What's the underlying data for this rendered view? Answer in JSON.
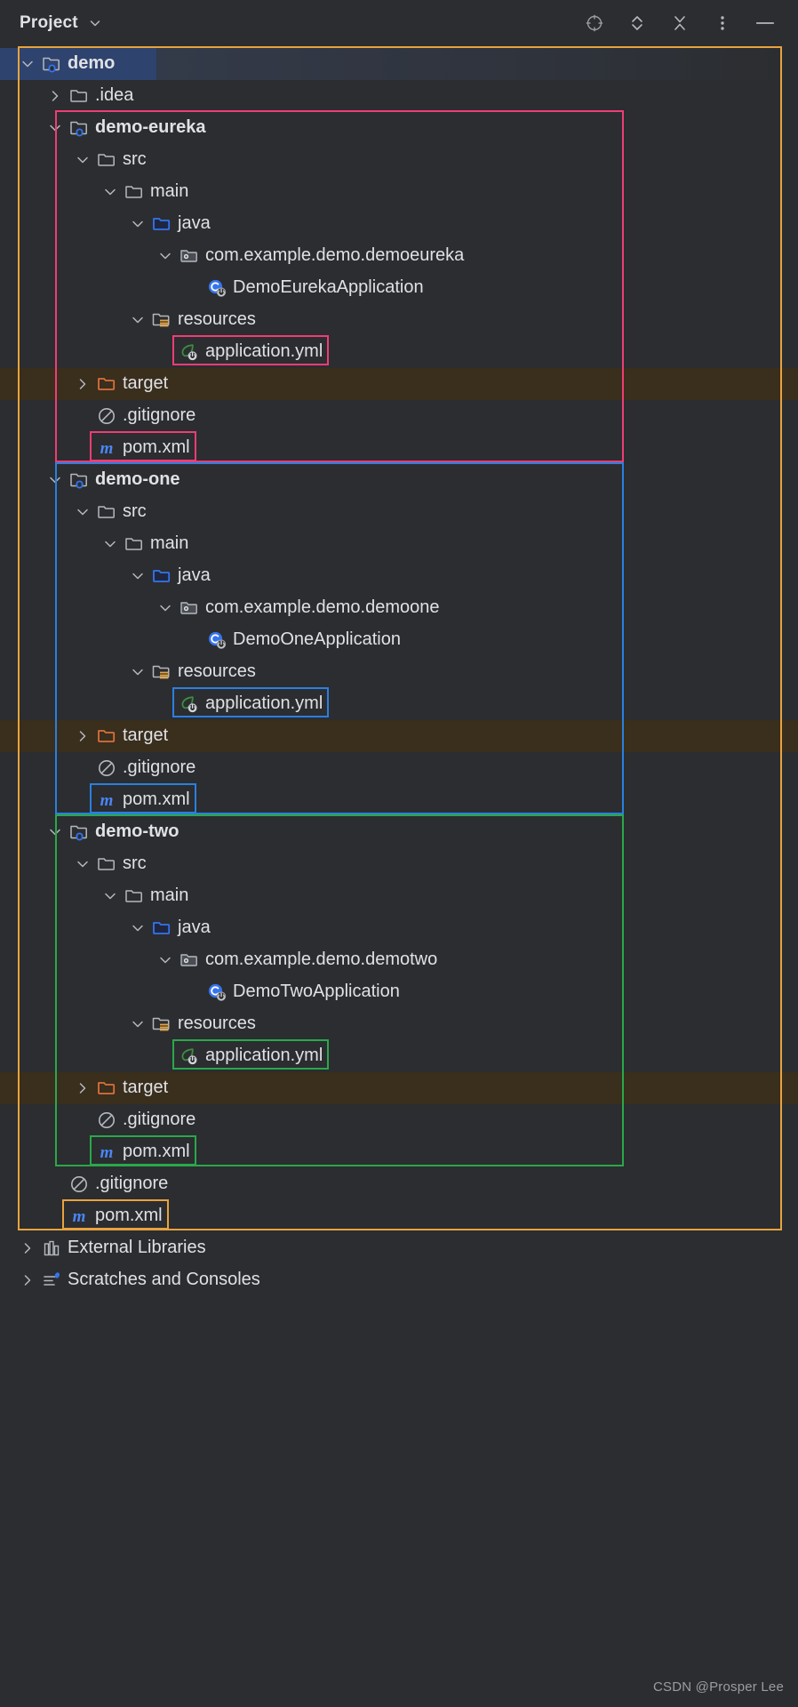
{
  "toolbar": {
    "title": "Project",
    "caret_icon": "chevron-down-icon",
    "actions": [
      {
        "name": "locate-in-tree",
        "icon": "crosshair-target-icon"
      },
      {
        "name": "expand-collapse",
        "icon": "chevron-up-down-icon"
      },
      {
        "name": "collapse-all",
        "icon": "collapse-all-icon"
      },
      {
        "name": "more-options",
        "icon": "vertical-dots-icon"
      },
      {
        "name": "hide-tool-window",
        "icon": "minimize-dash-icon"
      }
    ]
  },
  "colors": {
    "root_outline": "#e8a33d",
    "eureka_outline": "#ee3d74",
    "one_outline": "#2b7fe0",
    "two_outline": "#2aa84a",
    "selection": "#2e436e",
    "target_row_bg": "#3a2e1d",
    "background": "#2b2d30",
    "text": "#dfe1e5",
    "source_folder": "#3574f0",
    "target_folder": "#d9703b",
    "spring_leaf": "#3d8c40",
    "maven_m": "#4a86f7",
    "class_blue": "#3574f0"
  },
  "tree": [
    {
      "id": "demo",
      "label": "demo",
      "indent": 0,
      "arrow": "down",
      "icon": "module-folder-icon",
      "bold": true,
      "selected": true
    },
    {
      "id": "idea",
      "label": ".idea",
      "indent": 1,
      "arrow": "right",
      "icon": "folder-icon",
      "bold": false,
      "selected": false
    },
    {
      "id": "eureka",
      "label": "demo-eureka",
      "indent": 1,
      "arrow": "down",
      "icon": "module-folder-icon",
      "bold": true,
      "selected": false
    },
    {
      "id": "eureka-src",
      "label": "src",
      "indent": 2,
      "arrow": "down",
      "icon": "folder-icon",
      "bold": false,
      "selected": false
    },
    {
      "id": "eureka-main",
      "label": "main",
      "indent": 3,
      "arrow": "down",
      "icon": "folder-icon",
      "bold": false,
      "selected": false
    },
    {
      "id": "eureka-java",
      "label": "java",
      "indent": 4,
      "arrow": "down",
      "icon": "source-folder-icon",
      "bold": false,
      "selected": false
    },
    {
      "id": "eureka-pkg",
      "label": "com.example.demo.demoeureka",
      "indent": 5,
      "arrow": "down",
      "icon": "package-icon",
      "bold": false,
      "selected": false
    },
    {
      "id": "eureka-class",
      "label": "DemoEurekaApplication",
      "indent": 6,
      "arrow": "none",
      "icon": "java-class-run-icon",
      "bold": false,
      "selected": false
    },
    {
      "id": "eureka-res",
      "label": "resources",
      "indent": 4,
      "arrow": "down",
      "icon": "resource-folder-icon",
      "bold": false,
      "selected": false
    },
    {
      "id": "eureka-yml",
      "label": "application.yml",
      "indent": 5,
      "arrow": "none",
      "icon": "spring-leaf-icon",
      "bold": false,
      "selected": false,
      "highlight": "eureka_outline"
    },
    {
      "id": "eureka-target",
      "label": "target",
      "indent": 2,
      "arrow": "right",
      "icon": "target-folder-icon",
      "bold": false,
      "selected": false,
      "row_bg": "target"
    },
    {
      "id": "eureka-gitignore",
      "label": ".gitignore",
      "indent": 2,
      "arrow": "none",
      "icon": "gitignore-icon",
      "bold": false,
      "selected": false
    },
    {
      "id": "eureka-pom",
      "label": "pom.xml",
      "indent": 2,
      "arrow": "none",
      "icon": "maven-icon",
      "bold": false,
      "selected": false,
      "highlight": "eureka_outline"
    },
    {
      "id": "one",
      "label": "demo-one",
      "indent": 1,
      "arrow": "down",
      "icon": "module-folder-icon",
      "bold": true,
      "selected": false
    },
    {
      "id": "one-src",
      "label": "src",
      "indent": 2,
      "arrow": "down",
      "icon": "folder-icon",
      "bold": false,
      "selected": false
    },
    {
      "id": "one-main",
      "label": "main",
      "indent": 3,
      "arrow": "down",
      "icon": "folder-icon",
      "bold": false,
      "selected": false
    },
    {
      "id": "one-java",
      "label": "java",
      "indent": 4,
      "arrow": "down",
      "icon": "source-folder-icon",
      "bold": false,
      "selected": false
    },
    {
      "id": "one-pkg",
      "label": "com.example.demo.demoone",
      "indent": 5,
      "arrow": "down",
      "icon": "package-icon",
      "bold": false,
      "selected": false
    },
    {
      "id": "one-class",
      "label": "DemoOneApplication",
      "indent": 6,
      "arrow": "none",
      "icon": "java-class-run-icon",
      "bold": false,
      "selected": false
    },
    {
      "id": "one-res",
      "label": "resources",
      "indent": 4,
      "arrow": "down",
      "icon": "resource-folder-icon",
      "bold": false,
      "selected": false
    },
    {
      "id": "one-yml",
      "label": "application.yml",
      "indent": 5,
      "arrow": "none",
      "icon": "spring-leaf-icon",
      "bold": false,
      "selected": false,
      "highlight": "one_outline"
    },
    {
      "id": "one-target",
      "label": "target",
      "indent": 2,
      "arrow": "right",
      "icon": "target-folder-icon",
      "bold": false,
      "selected": false,
      "row_bg": "target"
    },
    {
      "id": "one-gitignore",
      "label": ".gitignore",
      "indent": 2,
      "arrow": "none",
      "icon": "gitignore-icon",
      "bold": false,
      "selected": false
    },
    {
      "id": "one-pom",
      "label": "pom.xml",
      "indent": 2,
      "arrow": "none",
      "icon": "maven-icon",
      "bold": false,
      "selected": false,
      "highlight": "one_outline"
    },
    {
      "id": "two",
      "label": "demo-two",
      "indent": 1,
      "arrow": "down",
      "icon": "module-folder-icon",
      "bold": true,
      "selected": false
    },
    {
      "id": "two-src",
      "label": "src",
      "indent": 2,
      "arrow": "down",
      "icon": "folder-icon",
      "bold": false,
      "selected": false
    },
    {
      "id": "two-main",
      "label": "main",
      "indent": 3,
      "arrow": "down",
      "icon": "folder-icon",
      "bold": false,
      "selected": false
    },
    {
      "id": "two-java",
      "label": "java",
      "indent": 4,
      "arrow": "down",
      "icon": "source-folder-icon",
      "bold": false,
      "selected": false
    },
    {
      "id": "two-pkg",
      "label": "com.example.demo.demotwo",
      "indent": 5,
      "arrow": "down",
      "icon": "package-icon",
      "bold": false,
      "selected": false
    },
    {
      "id": "two-class",
      "label": "DemoTwoApplication",
      "indent": 6,
      "arrow": "none",
      "icon": "java-class-run-icon",
      "bold": false,
      "selected": false
    },
    {
      "id": "two-res",
      "label": "resources",
      "indent": 4,
      "arrow": "down",
      "icon": "resource-folder-icon",
      "bold": false,
      "selected": false
    },
    {
      "id": "two-yml",
      "label": "application.yml",
      "indent": 5,
      "arrow": "none",
      "icon": "spring-leaf-icon",
      "bold": false,
      "selected": false,
      "highlight": "two_outline"
    },
    {
      "id": "two-target",
      "label": "target",
      "indent": 2,
      "arrow": "right",
      "icon": "target-folder-icon",
      "bold": false,
      "selected": false,
      "row_bg": "target"
    },
    {
      "id": "two-gitignore",
      "label": ".gitignore",
      "indent": 2,
      "arrow": "none",
      "icon": "gitignore-icon",
      "bold": false,
      "selected": false
    },
    {
      "id": "two-pom",
      "label": "pom.xml",
      "indent": 2,
      "arrow": "none",
      "icon": "maven-icon",
      "bold": false,
      "selected": false,
      "highlight": "two_outline"
    },
    {
      "id": "root-gitignore",
      "label": ".gitignore",
      "indent": 1,
      "arrow": "none",
      "icon": "gitignore-icon",
      "bold": false,
      "selected": false
    },
    {
      "id": "root-pom",
      "label": "pom.xml",
      "indent": 1,
      "arrow": "none",
      "icon": "maven-icon",
      "bold": false,
      "selected": false,
      "highlight": "root_outline"
    },
    {
      "id": "ext-libs",
      "label": "External Libraries",
      "indent": 0,
      "arrow": "right",
      "icon": "external-libraries-icon",
      "bold": false,
      "selected": false
    },
    {
      "id": "scratches",
      "label": "Scratches and Consoles",
      "indent": 0,
      "arrow": "right",
      "icon": "scratches-icon",
      "bold": false,
      "selected": false
    }
  ],
  "watermark": "CSDN @Prosper Lee"
}
